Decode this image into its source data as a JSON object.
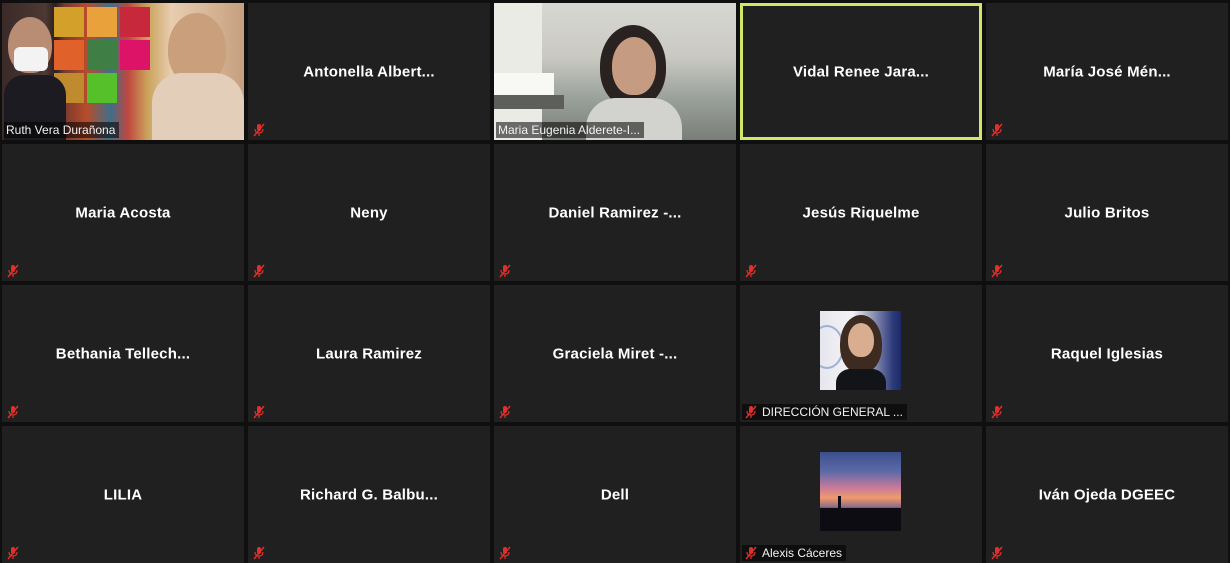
{
  "colors": {
    "tile_bg": "#202020",
    "active_border": "#cfe86a",
    "muted_icon": "#e0302c",
    "name_text": "#ffffff"
  },
  "participants": [
    {
      "name": "Ruth Vera Durañona",
      "type": "video"
    },
    {
      "name": "Antonella  Albert...",
      "type": "name"
    },
    {
      "name": "Maria Eugenia Alderete-I...",
      "type": "video"
    },
    {
      "name": "Vidal Renee Jara...",
      "type": "name",
      "active_speaker": true
    },
    {
      "name": "María José Mén...",
      "type": "name"
    },
    {
      "name": "Maria Acosta",
      "type": "name"
    },
    {
      "name": "Neny",
      "type": "name"
    },
    {
      "name": "Daniel Ramirez  -...",
      "type": "name"
    },
    {
      "name": "Jesús Riquelme",
      "type": "name"
    },
    {
      "name": "Julio Britos",
      "type": "name"
    },
    {
      "name": "Bethania  Tellech...",
      "type": "name"
    },
    {
      "name": "Laura Ramirez",
      "type": "name"
    },
    {
      "name": "Graciela Miret -...",
      "type": "name"
    },
    {
      "name": "DIRECCIÓN GENERAL ...",
      "type": "photo"
    },
    {
      "name": "Raquel Iglesias",
      "type": "name"
    },
    {
      "name": "LILIA",
      "type": "name"
    },
    {
      "name": "Richard  G.  Balbu...",
      "type": "name"
    },
    {
      "name": "Dell",
      "type": "name"
    },
    {
      "name": "Alexis Cáceres",
      "type": "photo"
    },
    {
      "name": "Iván Ojeda DGEEC",
      "type": "name"
    }
  ]
}
